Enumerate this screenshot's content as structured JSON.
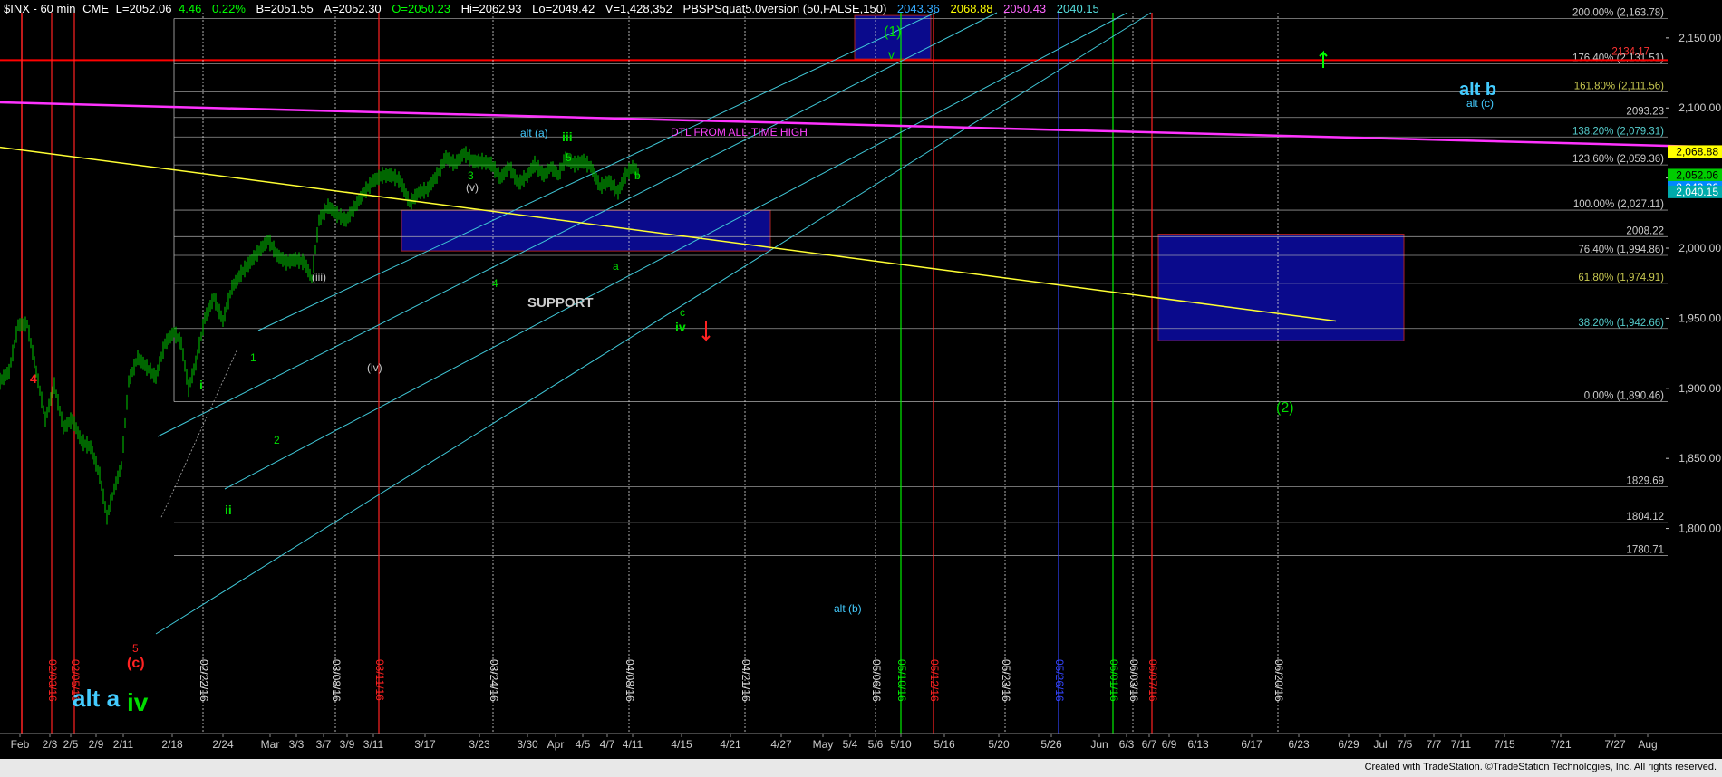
{
  "header": {
    "segments": [
      {
        "text": "$INX - 60 min",
        "color": "#ffffff"
      },
      {
        "text": "CME",
        "color": "#ffffff"
      },
      {
        "text": "L=2052.06",
        "color": "#ffffff"
      },
      {
        "text": "4.46",
        "color": "#00ff00"
      },
      {
        "text": "0.22%",
        "color": "#00ff00"
      },
      {
        "text": "B=2051.55",
        "color": "#ffffff"
      },
      {
        "text": "A=2052.30",
        "color": "#ffffff"
      },
      {
        "text": "O=2050.23",
        "color": "#00ff00"
      },
      {
        "text": "Hi=2062.93",
        "color": "#ffffff"
      },
      {
        "text": "Lo=2049.42",
        "color": "#ffffff"
      },
      {
        "text": "V=1,428,352",
        "color": "#ffffff"
      },
      {
        "text": "PBSPSquat5.0version (50,FALSE,150)",
        "color": "#ffffff"
      },
      {
        "text": "2043.36",
        "color": "#33aaff"
      },
      {
        "text": "2068.88",
        "color": "#ffff00"
      },
      {
        "text": "2050.43",
        "color": "#ff66ff"
      },
      {
        "text": "2040.15",
        "color": "#55dddd"
      }
    ]
  },
  "footer": {
    "text": "Created with TradeStation. ©TradeStation Technologies, Inc. All rights reserved."
  },
  "colors": {
    "background": "#000000",
    "candle": "#00cc00",
    "fib": "#cccccc",
    "channel": "#40c8d8",
    "dtl": "#ff33ff",
    "trend": "#ffff33",
    "red_line": "#ff0000",
    "box": "#0a0a8c"
  },
  "chart_data": {
    "type": "candlestick",
    "title": "$INX - 60 min",
    "ylim": [
      1770,
      2168
    ],
    "y_ticks": [
      1800,
      1850,
      1900,
      1950,
      2000,
      2050,
      2100,
      2150
    ],
    "y_tick_labels": [
      "1,800.00",
      "1,850.00",
      "1,900.00",
      "1,950.00",
      "2,000.00",
      "2,050.00",
      "2,100.00",
      "2,150.00"
    ],
    "x_ticks": [
      "Feb",
      "2/3",
      "2/5",
      "2/9",
      "2/11",
      "2/18",
      "2/24",
      "Mar",
      "3/3",
      "3/7",
      "3/9",
      "3/11",
      "3/17",
      "3/23",
      "3/30",
      "Apr",
      "4/5",
      "4/7",
      "4/11",
      "4/15",
      "4/21",
      "4/27",
      "May",
      "5/4",
      "5/6",
      "5/10",
      "5/16",
      "5/20",
      "5/26",
      "Jun",
      "6/3",
      "6/7",
      "6/9",
      "6/13",
      "6/17",
      "6/23",
      "6/29",
      "Jul",
      "7/5",
      "7/7",
      "7/11",
      "7/15",
      "7/21",
      "7/27",
      "Aug"
    ],
    "price_path": [
      [
        0,
        1905
      ],
      [
        10,
        1912
      ],
      [
        20,
        1945
      ],
      [
        30,
        1946
      ],
      [
        40,
        1912
      ],
      [
        50,
        1878
      ],
      [
        60,
        1902
      ],
      [
        70,
        1872
      ],
      [
        80,
        1878
      ],
      [
        90,
        1862
      ],
      [
        100,
        1858
      ],
      [
        110,
        1838
      ],
      [
        118,
        1808
      ],
      [
        126,
        1828
      ],
      [
        134,
        1845
      ],
      [
        142,
        1905
      ],
      [
        152,
        1922
      ],
      [
        162,
        1915
      ],
      [
        172,
        1908
      ],
      [
        182,
        1932
      ],
      [
        192,
        1940
      ],
      [
        200,
        1932
      ],
      [
        208,
        1900
      ],
      [
        216,
        1918
      ],
      [
        226,
        1950
      ],
      [
        236,
        1965
      ],
      [
        246,
        1948
      ],
      [
        256,
        1972
      ],
      [
        266,
        1982
      ],
      [
        276,
        1990
      ],
      [
        286,
        1998
      ],
      [
        296,
        2006
      ],
      [
        306,
        1995
      ],
      [
        316,
        1990
      ],
      [
        326,
        1992
      ],
      [
        336,
        1990
      ],
      [
        344,
        1978
      ],
      [
        352,
        2020
      ],
      [
        362,
        2030
      ],
      [
        372,
        2024
      ],
      [
        382,
        2020
      ],
      [
        392,
        2030
      ],
      [
        402,
        2040
      ],
      [
        412,
        2048
      ],
      [
        422,
        2052
      ],
      [
        432,
        2052
      ],
      [
        442,
        2048
      ],
      [
        452,
        2032
      ],
      [
        462,
        2040
      ],
      [
        472,
        2042
      ],
      [
        482,
        2052
      ],
      [
        492,
        2065
      ],
      [
        502,
        2060
      ],
      [
        512,
        2068
      ],
      [
        522,
        2062
      ],
      [
        532,
        2062
      ],
      [
        542,
        2060
      ],
      [
        552,
        2050
      ],
      [
        562,
        2058
      ],
      [
        572,
        2046
      ],
      [
        582,
        2052
      ],
      [
        590,
        2060
      ],
      [
        600,
        2052
      ],
      [
        608,
        2058
      ],
      [
        616,
        2052
      ],
      [
        624,
        2064
      ],
      [
        634,
        2060
      ],
      [
        644,
        2062
      ],
      [
        652,
        2058
      ],
      [
        662,
        2044
      ],
      [
        672,
        2048
      ],
      [
        682,
        2040
      ],
      [
        690,
        2052
      ],
      [
        698,
        2058
      ],
      [
        706,
        2052
      ]
    ],
    "fib_levels": [
      {
        "pct": "200.00%",
        "value": 2163.78,
        "label": "200.00% (2,163.78)",
        "color": "#cccccc"
      },
      {
        "pct": "176.40%",
        "value": 2131.51,
        "label": "176.40% (2,131.51)",
        "color": "#cccccc"
      },
      {
        "pct": "161.80%",
        "value": 2111.56,
        "label": "161.80% (2,111.56)",
        "color": "#c8c850"
      },
      {
        "value": 2093.23,
        "label": "2093.23",
        "color": "#cccccc"
      },
      {
        "pct": "138.20%",
        "value": 2079.31,
        "label": "138.20% (2,079.31)",
        "color": "#55cccc"
      },
      {
        "pct": "123.60%",
        "value": 2059.36,
        "label": "123.60% (2,059.36)",
        "color": "#cccccc"
      },
      {
        "pct": "100.00%",
        "value": 2027.11,
        "label": "100.00% (2,027.11)",
        "color": "#cccccc"
      },
      {
        "value": 2008.22,
        "label": "2008.22",
        "color": "#cccccc"
      },
      {
        "pct": "76.40%",
        "value": 1994.86,
        "label": "76.40% (1,994.86)",
        "color": "#cccccc"
      },
      {
        "pct": "61.80%",
        "value": 1974.91,
        "label": "61.80% (1,974.91)",
        "color": "#c8c850"
      },
      {
        "pct": "38.20%",
        "value": 1942.66,
        "label": "38.20% (1,942.66)",
        "color": "#55cccc"
      },
      {
        "pct": "0.00%",
        "value": 1890.46,
        "label": "0.00% (1,890.46)",
        "color": "#cccccc"
      },
      {
        "value": 1829.69,
        "label": "1829.69",
        "color": "#cccccc"
      },
      {
        "value": 1804.12,
        "label": "1804.12",
        "color": "#cccccc"
      },
      {
        "value": 1780.71,
        "label": "1780.71",
        "color": "#cccccc"
      }
    ],
    "red_level": {
      "value": 2134.17,
      "label": "2134.17"
    },
    "right_price_tags": [
      {
        "value": 2068.88,
        "label": "2,068.88",
        "bg": "#ffff00",
        "fg": "#000000"
      },
      {
        "value": 2052.06,
        "label": "2,052.06",
        "bg": "#00cc00",
        "fg": "#000000"
      },
      {
        "value": 2043.36,
        "label": "2,043.36",
        "bg": "#0088ff",
        "fg": "#ffffff"
      },
      {
        "value": 2040.15,
        "label": "2,040.15",
        "bg": "#00aaaa",
        "fg": "#ffffff"
      }
    ],
    "vertical_dates": [
      {
        "label": "02/03/16",
        "color": "#ff2222"
      },
      {
        "label": "02/05/16",
        "color": "#ff2222"
      },
      {
        "label": "02/22/16",
        "color": "#dddddd"
      },
      {
        "label": "03/08/16",
        "color": "#dddddd"
      },
      {
        "label": "03/11/16",
        "color": "#ff2222"
      },
      {
        "label": "03/24/16",
        "color": "#dddddd"
      },
      {
        "label": "04/08/16",
        "color": "#dddddd"
      },
      {
        "label": "04/21/16",
        "color": "#dddddd"
      },
      {
        "label": "05/06/16",
        "color": "#dddddd"
      },
      {
        "label": "05/10/16",
        "color": "#00ee00"
      },
      {
        "label": "05/12/16",
        "color": "#ff2222"
      },
      {
        "label": "05/23/16",
        "color": "#dddddd"
      },
      {
        "label": "05/26/16",
        "color": "#3344ff"
      },
      {
        "label": "06/01/16",
        "color": "#00ee00"
      },
      {
        "label": "06/03/16",
        "color": "#dddddd"
      },
      {
        "label": "06/07/16",
        "color": "#ff2222"
      },
      {
        "label": "06/20/16",
        "color": "#dddddd"
      }
    ],
    "annotations": {
      "dtl": "DTL FROM ALL-TIME HIGH",
      "support": "SUPPORT",
      "alt_b": "alt b",
      "alt_c": "alt (c)",
      "alt_a_top": "alt (a)",
      "alt_a_big": "alt a",
      "alt_b_small": "alt (b)",
      "wave_1": "(1)",
      "wave_v": "v",
      "wave_2": "(2)",
      "iii_top": "iii",
      "iv_top": "iv",
      "iv_big": "iv",
      "w5_top": "5",
      "w3_top": "3",
      "w_v_paren": "(v)",
      "w_b": "b",
      "w_a": "a",
      "w_c": "c",
      "w_4": "4",
      "w_iii_paren": "(iii)",
      "w_iv_paren": "(iv)",
      "w_i": "i",
      "w_ii": "ii",
      "w_1": "1",
      "w_2": "2",
      "w_red4": "4",
      "w_red5": "5",
      "w_redc": "(c)"
    }
  }
}
